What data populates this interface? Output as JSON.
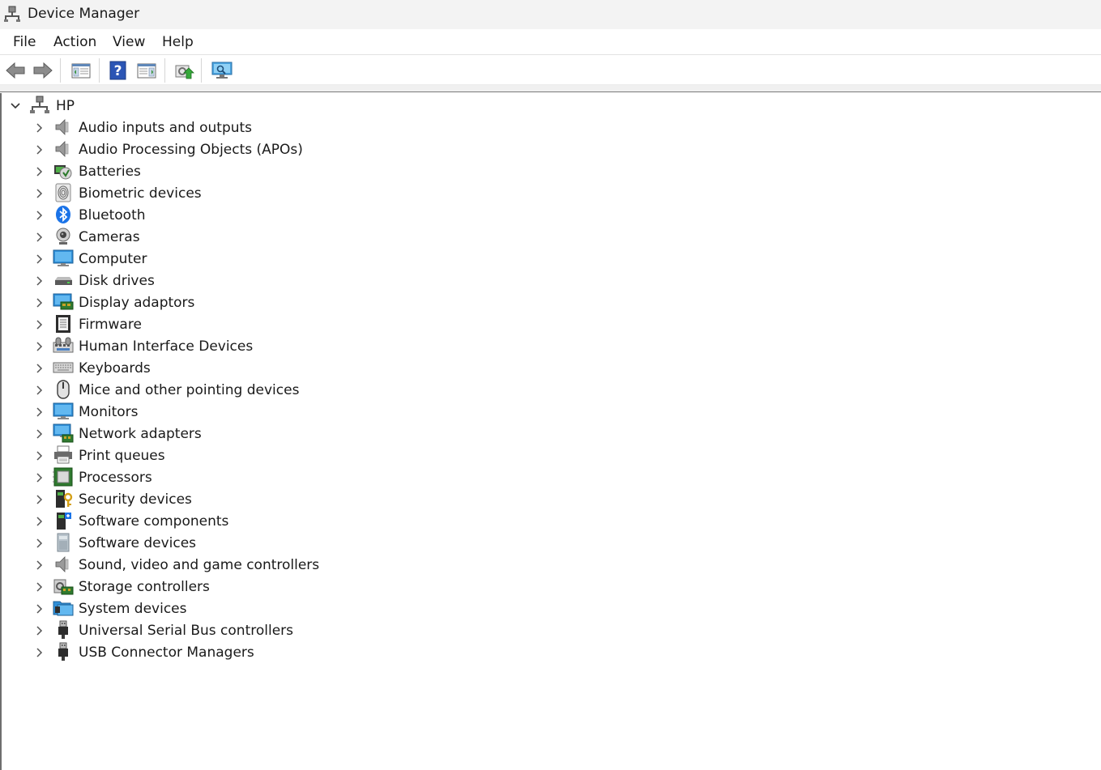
{
  "window": {
    "title": "Device Manager"
  },
  "menu": {
    "file": "File",
    "action": "Action",
    "view": "View",
    "help": "Help"
  },
  "toolbar": {
    "buttons": [
      {
        "name": "back-icon"
      },
      {
        "name": "forward-icon"
      },
      {
        "name": "show-hide-console-tree-icon"
      },
      {
        "name": "help-icon"
      },
      {
        "name": "show-hide-action-pane-icon"
      },
      {
        "name": "update-driver-icon"
      },
      {
        "name": "scan-hardware-changes-icon"
      }
    ]
  },
  "tree": {
    "root": {
      "label": "HP",
      "icon": "computer-network-icon",
      "expanded": true
    },
    "items": [
      {
        "label": "Audio inputs and outputs",
        "icon": "speaker-icon"
      },
      {
        "label": "Audio Processing Objects (APOs)",
        "icon": "speaker-icon"
      },
      {
        "label": "Batteries",
        "icon": "battery-icon"
      },
      {
        "label": "Biometric devices",
        "icon": "fingerprint-icon"
      },
      {
        "label": "Bluetooth",
        "icon": "bluetooth-icon"
      },
      {
        "label": "Cameras",
        "icon": "webcam-icon"
      },
      {
        "label": "Computer",
        "icon": "monitor-icon"
      },
      {
        "label": "Disk drives",
        "icon": "disk-drive-icon"
      },
      {
        "label": "Display adaptors",
        "icon": "display-adapter-icon"
      },
      {
        "label": "Firmware",
        "icon": "firmware-chip-icon"
      },
      {
        "label": "Human Interface Devices",
        "icon": "hid-icon"
      },
      {
        "label": "Keyboards",
        "icon": "keyboard-icon"
      },
      {
        "label": "Mice and other pointing devices",
        "icon": "mouse-icon"
      },
      {
        "label": "Monitors",
        "icon": "monitor-icon"
      },
      {
        "label": "Network adapters",
        "icon": "network-adapter-icon"
      },
      {
        "label": "Print queues",
        "icon": "printer-icon"
      },
      {
        "label": "Processors",
        "icon": "processor-icon"
      },
      {
        "label": "Security devices",
        "icon": "security-key-icon"
      },
      {
        "label": "Software components",
        "icon": "software-component-icon"
      },
      {
        "label": "Software devices",
        "icon": "software-device-icon"
      },
      {
        "label": "Sound, video and game controllers",
        "icon": "speaker-icon"
      },
      {
        "label": "Storage controllers",
        "icon": "storage-controller-icon"
      },
      {
        "label": "System devices",
        "icon": "system-folder-icon"
      },
      {
        "label": "Universal Serial Bus controllers",
        "icon": "usb-plug-icon"
      },
      {
        "label": "USB Connector Managers",
        "icon": "usb-plug-icon"
      }
    ]
  }
}
